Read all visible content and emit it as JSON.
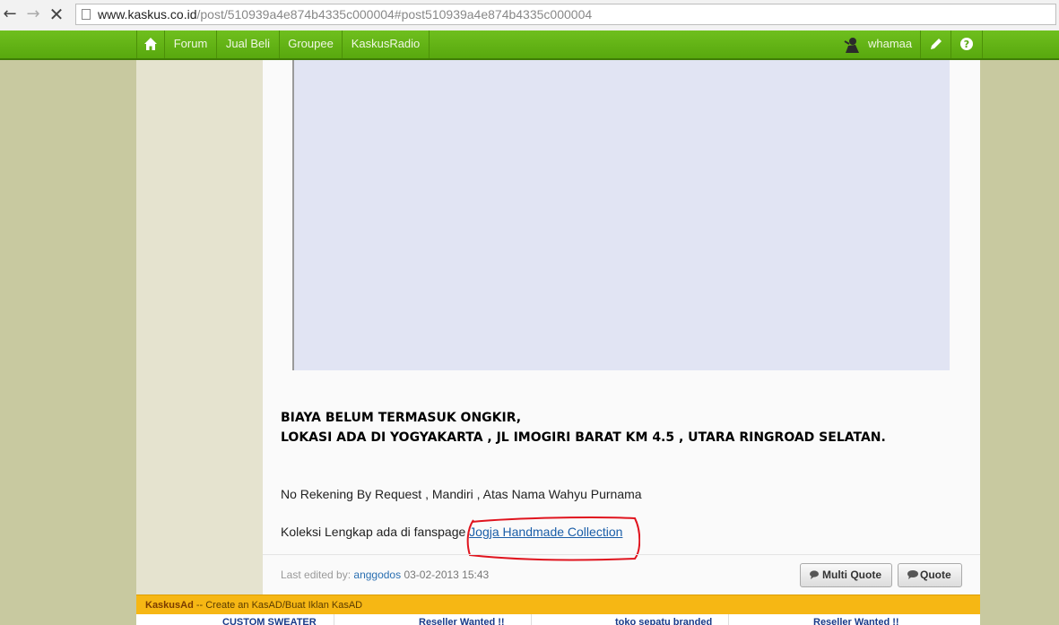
{
  "browser": {
    "url_host": "www.kaskus.co.id",
    "url_path": "/post/510939a4e874b4335c000004#post510939a4e874b4335c000004"
  },
  "navbar": {
    "items": [
      "Forum",
      "Jual Beli",
      "Groupee",
      "KaskusRadio"
    ],
    "username": "whamaa"
  },
  "post": {
    "bold_line_1": "BIAYA BELUM TERMASUK ONGKIR,",
    "bold_line_2": "LOKASI ADA DI YOGYAKARTA , JL IMOGIRI BARAT KM 4.5 , UTARA RINGROAD SELATAN.",
    "rekening": "No Rekening By Request , Mandiri , Atas Nama Wahyu Purnama",
    "koleksi_prefix": "Koleksi Lengkap ada di fanspage ",
    "fanspage_link": "Jogja Handmade Collection",
    "edited_prefix": "Last edited by: ",
    "edited_by": "anggodos",
    "edited_at": "03-02-2013 15:43",
    "multi_quote": "Multi Quote",
    "quote": "Quote"
  },
  "kaskusad": {
    "brand": "KaskusAd",
    "tagline": " -- Create an KasAD/Buat Iklan KasAD"
  },
  "ads": [
    "CUSTOM SWEATER",
    "Reseller Wanted !!",
    "toko sepatu branded",
    "Reseller Wanted !!"
  ],
  "colors": {
    "navbar_green": "#63b316",
    "kaskusad_bar": "#f6b714",
    "annotation_circle": "#e0141e"
  }
}
